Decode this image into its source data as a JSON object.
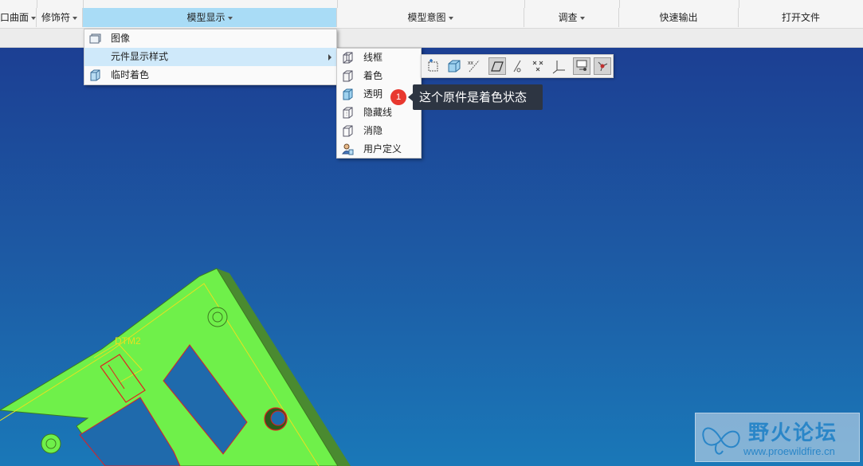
{
  "ribbon": {
    "tabs": [
      {
        "label": "口曲面",
        "active": false
      },
      {
        "label": "修饰符",
        "active": false
      },
      {
        "label": "模型显示",
        "active": true
      },
      {
        "label": "模型意图",
        "active": false
      },
      {
        "label": "调查",
        "active": false
      },
      {
        "label": "快速输出",
        "active": false
      },
      {
        "label": "打开文件",
        "active": false
      }
    ]
  },
  "model_display_menu": {
    "items": [
      {
        "label": "图像",
        "icon": "image-icon",
        "has_submenu": false,
        "highlighted": false
      },
      {
        "label": "元件显示样式",
        "icon": "",
        "has_submenu": true,
        "highlighted": true
      },
      {
        "label": "临时着色",
        "icon": "temp-shade-icon",
        "has_submenu": false,
        "highlighted": false
      }
    ]
  },
  "display_style_submenu": {
    "items": [
      {
        "label": "线框",
        "icon": "wireframe-icon"
      },
      {
        "label": "着色",
        "icon": "shaded-icon"
      },
      {
        "label": "透明",
        "icon": "transparent-icon"
      },
      {
        "label": "隐藏线",
        "icon": "hidden-line-icon"
      },
      {
        "label": "消隐",
        "icon": "no-hidden-icon"
      },
      {
        "label": "用户定义",
        "icon": "user-defined-icon"
      }
    ]
  },
  "view_toolbar": {
    "buttons": [
      {
        "icon": "zoom-fit-icon",
        "selected": false
      },
      {
        "icon": "display-style-icon",
        "selected": false
      },
      {
        "icon": "axis-display-icon",
        "selected": false
      },
      {
        "icon": "plane-display-icon",
        "selected": true
      },
      {
        "icon": "axis-tag-icon",
        "selected": false
      },
      {
        "icon": "point-display-icon",
        "selected": false
      },
      {
        "icon": "csys-display-icon",
        "selected": false
      },
      {
        "icon": "annotation-display-icon",
        "selected": true
      },
      {
        "icon": "spin-center-icon",
        "selected": true
      }
    ]
  },
  "annotation": {
    "badge": "1",
    "tooltip": "这个原件是着色状态"
  },
  "model": {
    "label": "DTM2",
    "fill_color": "#6ff04a",
    "edge_color": "#e02020"
  },
  "watermark": {
    "title": "野火论坛",
    "url": "www.proewildfire.cn"
  },
  "colors": {
    "background_top": "#1c3f93",
    "background_bottom": "#1a78b8",
    "active_tab": "#a9dcf6",
    "menu_highlight": "#cfe9fa",
    "badge": "#e8382f"
  }
}
